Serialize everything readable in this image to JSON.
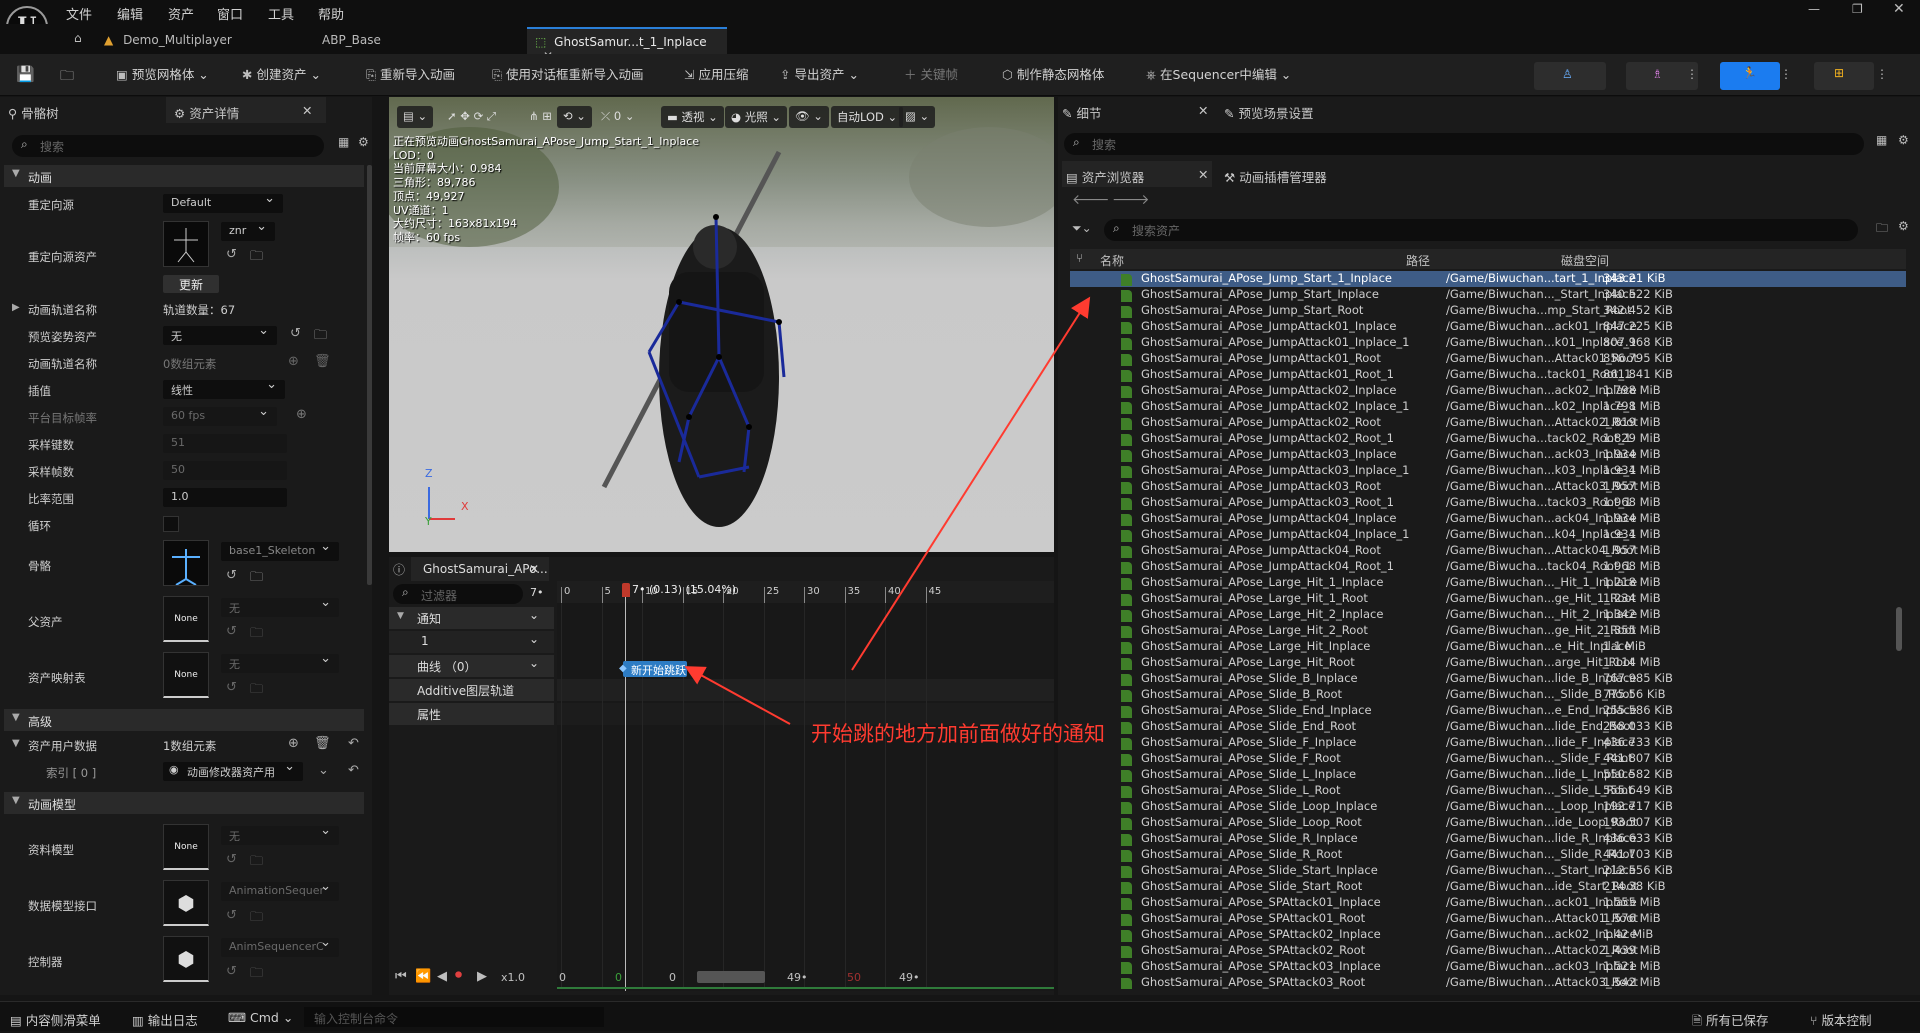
{
  "menu": [
    "文件",
    "编辑",
    "资产",
    "窗口",
    "工具",
    "帮助"
  ],
  "tabs": [
    {
      "label": "Demo_Multiplayer"
    },
    {
      "label": "ABP_Base"
    },
    {
      "label": "GhostSamur...t_1_Inplace"
    }
  ],
  "toolbar": {
    "preview_mesh": "预览网格体",
    "create_asset": "创建资产",
    "reimport": "重新导入动画",
    "reimport_dialog": "使用对话框重新导入动画",
    "apply_compression": "应用压缩",
    "export_asset": "导出资产",
    "keyframe": "关键帧",
    "make_static_mesh": "制作静态网格体",
    "edit_in_sequencer": "在Sequencer中编辑"
  },
  "left_panel": {
    "tab_skeleton": "骨骼树",
    "tab_details": "资产详情",
    "search_placeholder": "搜索",
    "sections": {
      "animation": "动画",
      "advanced": "高级",
      "asset_user_data": "资产用户数据",
      "anim_model": "动画模型"
    },
    "props": {
      "retarget_source": {
        "label": "重定向源",
        "value": "Default"
      },
      "retarget_source_asset": {
        "label": "重定向源资产",
        "znr": "znr",
        "update": "更新"
      },
      "track_names": {
        "label": "动画轨道名称",
        "value": "轨道数量：67"
      },
      "preview_pose": {
        "label": "预览姿势资产",
        "value": "无"
      },
      "anim_track_names": {
        "label": "动画轨道名称",
        "value": "0数组元素"
      },
      "interp": {
        "label": "插值",
        "value": "线性"
      },
      "platform_rate": {
        "label": "平台目标帧率",
        "value": "60 fps"
      },
      "sampled_keys": {
        "label": "采样键数",
        "value": "51"
      },
      "sampled_frames": {
        "label": "采样帧数",
        "value": "50"
      },
      "rate_scale": {
        "label": "比率范围",
        "value": "1.0"
      },
      "loop": {
        "label": "循环"
      },
      "skeleton": {
        "label": "骨骼",
        "value": "base1_Skeleton"
      },
      "parent_asset": {
        "label": "父资产",
        "value": "无",
        "thumb": "None"
      },
      "asset_map": {
        "label": "资产映射表",
        "value": "无",
        "thumb": "None"
      },
      "user_data": {
        "label": "资产用户数据",
        "value": "1数组元素"
      },
      "index0": {
        "label": "索引 [ 0 ]",
        "value": "动画修改器资产用"
      },
      "data_model": {
        "label": "资料模型",
        "value": "无",
        "thumb": "None"
      },
      "data_model_interface": {
        "label": "数据模型接口",
        "value": "AnimationSequer"
      },
      "controller": {
        "label": "控制器",
        "value": "AnimSequencerC"
      }
    }
  },
  "viewport": {
    "toolbar": {
      "perspective": "透视",
      "lighting": "光照",
      "lod": "自动LOD",
      "zero": "0"
    },
    "info": [
      "正在预览动画GhostSamurai_APose_Jump_Start_1_Inplace",
      "LOD：0",
      "当前屏幕大小：0.984",
      "三角形：89,786",
      "顶点：49,927",
      "UV通道：1",
      "大约尺寸：163x81x194",
      "帧率：60 fps"
    ],
    "axes": {
      "z": "Z",
      "y": "Y",
      "x": "X"
    }
  },
  "timeline": {
    "tab": "GhostSamurai_APo...",
    "filter_placeholder": "过滤器",
    "frame_field": "7•",
    "playhead": "7• (0.13) (15.04%)",
    "ticks": [
      "0",
      "5",
      "10",
      "15",
      "20",
      "25",
      "30",
      "35",
      "40",
      "45"
    ],
    "tracks": {
      "notify": "通知",
      "notify_track": "1",
      "curves": "曲线 （0）",
      "additive": "Additive图层轨道",
      "attributes": "属性"
    },
    "notify_marker": "新开始跳跃",
    "transport": {
      "speed": "x1.0",
      "start": "0",
      "cur": "0",
      "zero": "0",
      "end1": "49•",
      "mid": "50",
      "end2": "49•"
    }
  },
  "annotation": "开始跳的地方加前面做好的通知",
  "right_panel": {
    "tab_details": "细节",
    "tab_preview_settings": "预览场景设置",
    "search_placeholder": "搜索",
    "tab_content_browser": "资产浏览器",
    "tab_anim_slot": "动画插槽管理器",
    "asset_search_placeholder": "搜索资产",
    "columns": {
      "name": "名称",
      "path": "路径",
      "size": "磁盘空间"
    },
    "rows": [
      [
        "GhostSamurai_APose_Jump_Start_1_Inplace",
        "/Game/Biwuchan...tart_1_Inplace",
        "343.21 KiB"
      ],
      [
        "GhostSamurai_APose_Jump_Start_Inplace",
        "/Game/Biwuchan..._Start_Inplace",
        "340.522 KiB"
      ],
      [
        "GhostSamurai_APose_Jump_Start_Root",
        "/Game/Biwucha...mp_Start_Root",
        "342.452 KiB"
      ],
      [
        "GhostSamurai_APose_JumpAttack01_Inplace",
        "/Game/Biwuchan...ack01_Inplace",
        "847.225 KiB"
      ],
      [
        "GhostSamurai_APose_JumpAttack01_Inplace_1",
        "/Game/Biwuchan...k01_Inplace_1",
        "807.968 KiB"
      ],
      [
        "GhostSamurai_APose_JumpAttack01_Root",
        "/Game/Biwuchan...Attack01_Root",
        "856.795 KiB"
      ],
      [
        "GhostSamurai_APose_JumpAttack01_Root_1",
        "/Game/Biwucha...tack01_Root_1",
        "861.841 KiB"
      ],
      [
        "GhostSamurai_APose_JumpAttack02_Inplace",
        "/Game/Biwuchan...ack02_Inplace",
        "1.798 MiB"
      ],
      [
        "GhostSamurai_APose_JumpAttack02_Inplace_1",
        "/Game/Biwuchan...k02_Inplace_1",
        "1.798 MiB"
      ],
      [
        "GhostSamurai_APose_JumpAttack02_Root",
        "/Game/Biwuchan...Attack02_Root",
        "1.819 MiB"
      ],
      [
        "GhostSamurai_APose_JumpAttack02_Root_1",
        "/Game/Biwucha...tack02_Root_1",
        "1.829 MiB"
      ],
      [
        "GhostSamurai_APose_JumpAttack03_Inplace",
        "/Game/Biwuchan...ack03_Inplace",
        "1.934 MiB"
      ],
      [
        "GhostSamurai_APose_JumpAttack03_Inplace_1",
        "/Game/Biwuchan...k03_Inplace_1",
        "1.934 MiB"
      ],
      [
        "GhostSamurai_APose_JumpAttack03_Root",
        "/Game/Biwuchan...Attack03_Root",
        "1.957 MiB"
      ],
      [
        "GhostSamurai_APose_JumpAttack03_Root_1",
        "/Game/Biwucha...tack03_Root_1",
        "1.968 MiB"
      ],
      [
        "GhostSamurai_APose_JumpAttack04_Inplace",
        "/Game/Biwuchan...ack04_Inplace",
        "1.934 MiB"
      ],
      [
        "GhostSamurai_APose_JumpAttack04_Inplace_1",
        "/Game/Biwuchan...k04_Inplace_1",
        "1.934 MiB"
      ],
      [
        "GhostSamurai_APose_JumpAttack04_Root",
        "/Game/Biwuchan...Attack04_Root",
        "1.957 MiB"
      ],
      [
        "GhostSamurai_APose_JumpAttack04_Root_1",
        "/Game/Biwucha...tack04_Root_1",
        "1.968 MiB"
      ],
      [
        "GhostSamurai_APose_Large_Hit_1_Inplace",
        "/Game/Biwuchan..._Hit_1_Inplace",
        "1.218 MiB"
      ],
      [
        "GhostSamurai_APose_Large_Hit_1_Root",
        "/Game/Biwuchan...ge_Hit_1_Root",
        "1.234 MiB"
      ],
      [
        "GhostSamurai_APose_Large_Hit_2_Inplace",
        "/Game/Biwuchan..._Hit_2_Inplace",
        "1.342 MiB"
      ],
      [
        "GhostSamurai_APose_Large_Hit_2_Root",
        "/Game/Biwuchan...ge_Hit_2_Root",
        "1.355 MiB"
      ],
      [
        "GhostSamurai_APose_Large_Hit_Inplace",
        "/Game/Biwuchan...e_Hit_Inplace",
        "1.1 MiB"
      ],
      [
        "GhostSamurai_APose_Large_Hit_Root",
        "/Game/Biwuchan...arge_Hit_Root",
        "1.114 MiB"
      ],
      [
        "GhostSamurai_APose_Slide_B_Inplace",
        "/Game/Biwuchan...lide_B_Inplace",
        "767.985 KiB"
      ],
      [
        "GhostSamurai_APose_Slide_B_Root",
        "/Game/Biwuchan..._Slide_B_Root",
        "775.56 KiB"
      ],
      [
        "GhostSamurai_APose_Slide_End_Inplace",
        "/Game/Biwuchan...e_End_Inplace",
        "255.586 KiB"
      ],
      [
        "GhostSamurai_APose_Slide_End_Root",
        "/Game/Biwuchan...lide_End_Root",
        "258.033 KiB"
      ],
      [
        "GhostSamurai_APose_Slide_F_Inplace",
        "/Game/Biwuchan...lide_F_Inplace",
        "436.733 KiB"
      ],
      [
        "GhostSamurai_APose_Slide_F_Root",
        "/Game/Biwuchan..._Slide_F_Root",
        "441.807 KiB"
      ],
      [
        "GhostSamurai_APose_Slide_L_Inplace",
        "/Game/Biwuchan...lide_L_Inplace",
        "550.582 KiB"
      ],
      [
        "GhostSamurai_APose_Slide_L_Root",
        "/Game/Biwuchan..._Slide_L_Root",
        "555.649 KiB"
      ],
      [
        "GhostSamurai_APose_Slide_Loop_Inplace",
        "/Game/Biwuchan..._Loop_Inplace",
        "192.717 KiB"
      ],
      [
        "GhostSamurai_APose_Slide_Loop_Root",
        "/Game/Biwuchan...ide_Loop_Root",
        "193.507 KiB"
      ],
      [
        "GhostSamurai_APose_Slide_R_Inplace",
        "/Game/Biwuchan...lide_R_Inplace",
        "436.633 KiB"
      ],
      [
        "GhostSamurai_APose_Slide_R_Root",
        "/Game/Biwuchan..._Slide_R_Root",
        "441.703 KiB"
      ],
      [
        "GhostSamurai_APose_Slide_Start_Inplace",
        "/Game/Biwuchan..._Start_Inplace",
        "212.556 KiB"
      ],
      [
        "GhostSamurai_APose_Slide_Start_Root",
        "/Game/Biwuchan...ide_Start_Root",
        "214.38 KiB"
      ],
      [
        "GhostSamurai_APose_SPAttack01_Inplace",
        "/Game/Biwuchan...ack01_Inplace",
        "1.555 MiB"
      ],
      [
        "GhostSamurai_APose_SPAttack01_Root",
        "/Game/Biwuchan...Attack01_Root",
        "1.576 MiB"
      ],
      [
        "GhostSamurai_APose_SPAttack02_Inplace",
        "/Game/Biwuchan...ack02_Inplace",
        "1.42 MiB"
      ],
      [
        "GhostSamurai_APose_SPAttack02_Root",
        "/Game/Biwuchan...Attack02_Root",
        "1.439 MiB"
      ],
      [
        "GhostSamurai_APose_SPAttack03_Inplace",
        "/Game/Biwuchan...ack03_Inplace",
        "1.521 MiB"
      ],
      [
        "GhostSamurai_APose_SPAttack03_Root",
        "/Game/Biwuchan...Attack03_Root",
        "1.542 MiB"
      ]
    ]
  },
  "statusbar": {
    "content_drawer": "内容侧滑菜单",
    "output_log": "输出日志",
    "cmd": "Cmd",
    "console_placeholder": "输入控制台命令",
    "all_saved": "所有已保存",
    "source_control": "版本控制"
  },
  "colors": {
    "accent": "#2a7fd8",
    "selected_row": "#3e5c86",
    "annotation": "#ff3b30",
    "notify_marker": "#2d7cc4"
  }
}
